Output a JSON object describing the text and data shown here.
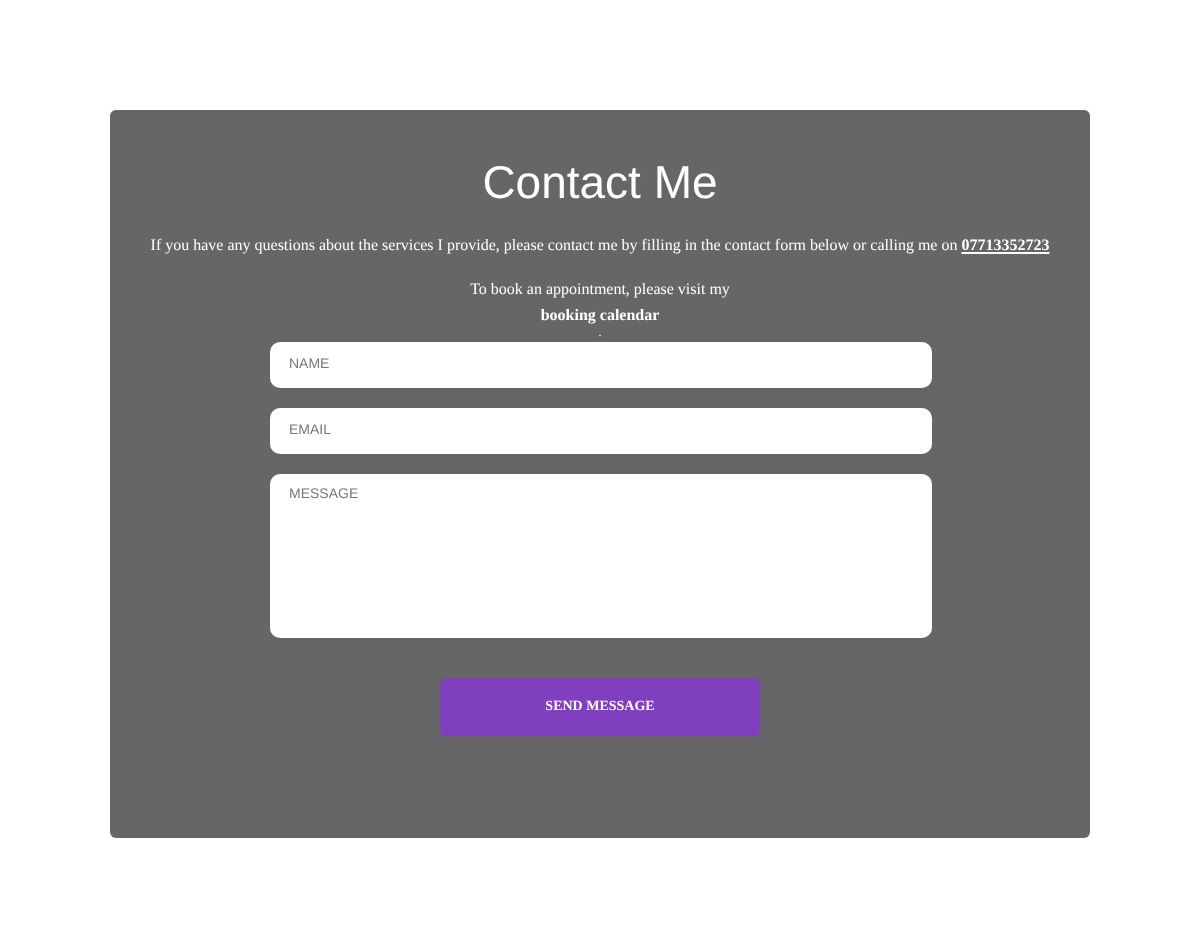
{
  "title": "Contact Me",
  "intro": {
    "text": "If you have any questions about the services I provide, please contact me by filling in the contact form below or calling me on",
    "phone": "07713352723"
  },
  "booking": {
    "text": "To book an appointment, please visit my",
    "link": "booking calendar",
    "trail": "."
  },
  "fields": [
    {
      "kind": "input",
      "placeholder": "NAME"
    },
    {
      "kind": "input",
      "placeholder": "EMAIL"
    },
    {
      "kind": "textarea",
      "placeholder": "MESSAGE"
    }
  ],
  "submit": "SEND MESSAGE"
}
